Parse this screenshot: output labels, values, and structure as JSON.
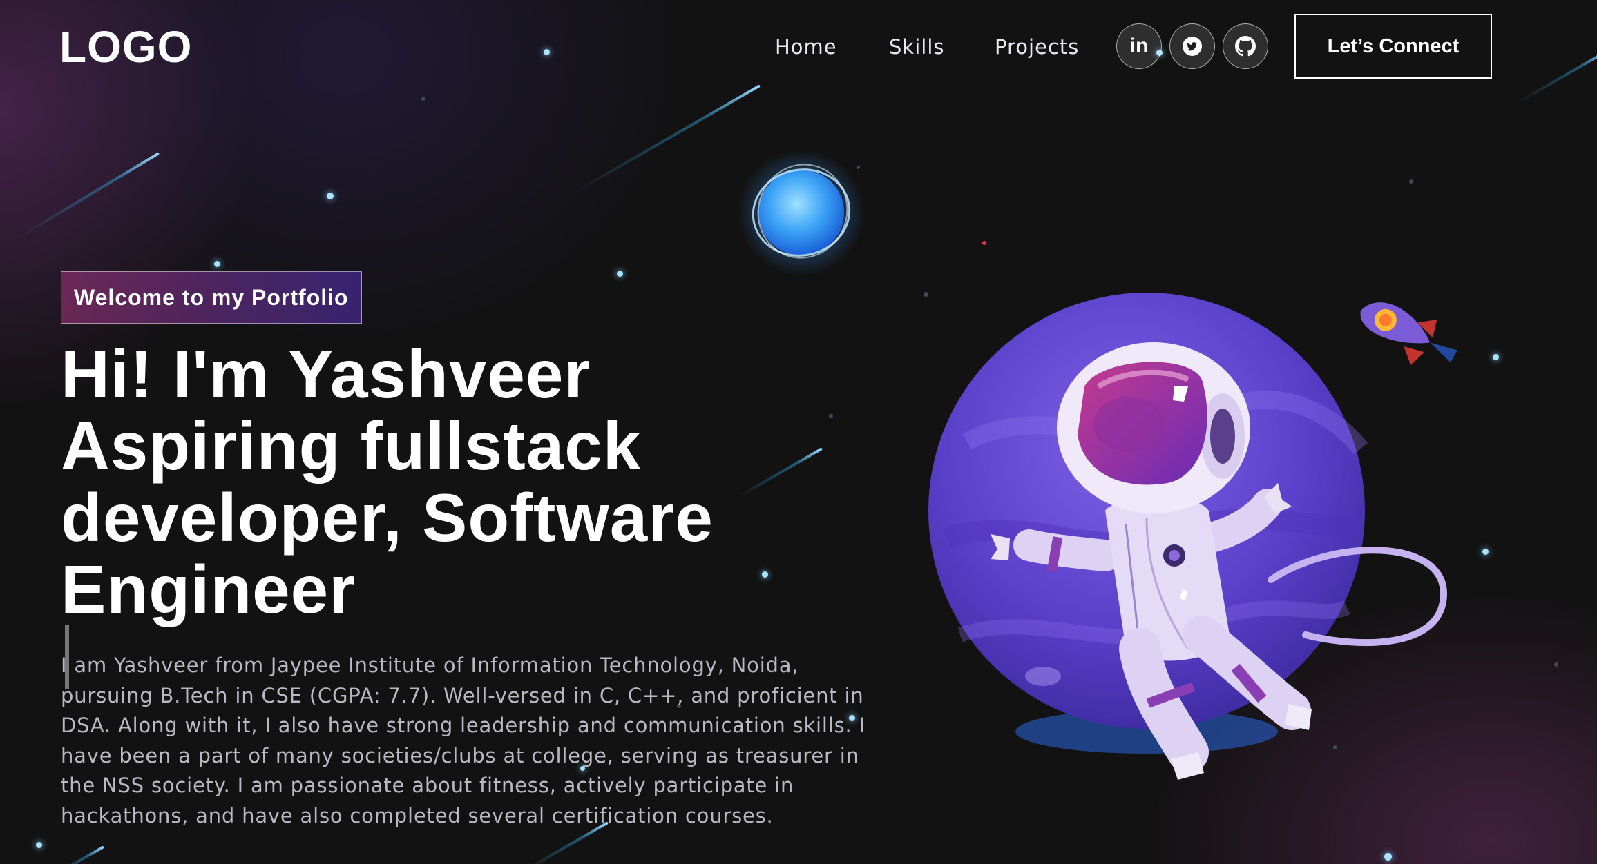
{
  "navbar": {
    "logo": "LOGO",
    "links": [
      "Home",
      "Skills",
      "Projects"
    ],
    "social": [
      "linkedin-icon",
      "twitter-icon",
      "github-icon"
    ],
    "connect_label": "Let’s Connect"
  },
  "hero": {
    "tagline": "Welcome to my Portfolio",
    "headline_lines": [
      "Hi! I'm Yashveer",
      "Aspiring fullstack",
      "developer, Software",
      "Engineer"
    ],
    "bio": "I am Yashveer from Jaypee Institute of Information Technology, Noida, pursuing B.Tech in CSE (CGPA: 7.7). Well-versed in C, C++, and proficient in DSA. Along with it, I also have strong leadership and communication skills. I have been a part of many societies/clubs at college, serving as treasurer in the NSS society. I am passionate about fitness, actively participate in hackathons, and have also completed several certification courses."
  },
  "colors": {
    "background": "#121212",
    "tagline_gradient_start": "#AA367C",
    "tagline_gradient_end": "#4A2FBD",
    "planet": "#6a4fd8"
  }
}
